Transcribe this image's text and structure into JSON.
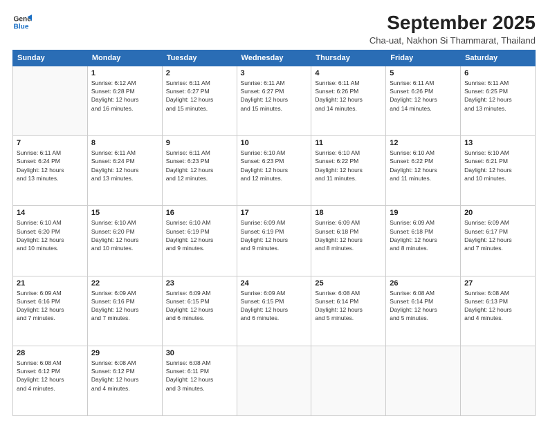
{
  "logo": {
    "line1": "General",
    "line2": "Blue"
  },
  "title": "September 2025",
  "subtitle": "Cha-uat, Nakhon Si Thammarat, Thailand",
  "days_of_week": [
    "Sunday",
    "Monday",
    "Tuesday",
    "Wednesday",
    "Thursday",
    "Friday",
    "Saturday"
  ],
  "weeks": [
    [
      {
        "day": "",
        "info": ""
      },
      {
        "day": "1",
        "info": "Sunrise: 6:12 AM\nSunset: 6:28 PM\nDaylight: 12 hours\nand 16 minutes."
      },
      {
        "day": "2",
        "info": "Sunrise: 6:11 AM\nSunset: 6:27 PM\nDaylight: 12 hours\nand 15 minutes."
      },
      {
        "day": "3",
        "info": "Sunrise: 6:11 AM\nSunset: 6:27 PM\nDaylight: 12 hours\nand 15 minutes."
      },
      {
        "day": "4",
        "info": "Sunrise: 6:11 AM\nSunset: 6:26 PM\nDaylight: 12 hours\nand 14 minutes."
      },
      {
        "day": "5",
        "info": "Sunrise: 6:11 AM\nSunset: 6:26 PM\nDaylight: 12 hours\nand 14 minutes."
      },
      {
        "day": "6",
        "info": "Sunrise: 6:11 AM\nSunset: 6:25 PM\nDaylight: 12 hours\nand 13 minutes."
      }
    ],
    [
      {
        "day": "7",
        "info": "Sunrise: 6:11 AM\nSunset: 6:24 PM\nDaylight: 12 hours\nand 13 minutes."
      },
      {
        "day": "8",
        "info": "Sunrise: 6:11 AM\nSunset: 6:24 PM\nDaylight: 12 hours\nand 13 minutes."
      },
      {
        "day": "9",
        "info": "Sunrise: 6:11 AM\nSunset: 6:23 PM\nDaylight: 12 hours\nand 12 minutes."
      },
      {
        "day": "10",
        "info": "Sunrise: 6:10 AM\nSunset: 6:23 PM\nDaylight: 12 hours\nand 12 minutes."
      },
      {
        "day": "11",
        "info": "Sunrise: 6:10 AM\nSunset: 6:22 PM\nDaylight: 12 hours\nand 11 minutes."
      },
      {
        "day": "12",
        "info": "Sunrise: 6:10 AM\nSunset: 6:22 PM\nDaylight: 12 hours\nand 11 minutes."
      },
      {
        "day": "13",
        "info": "Sunrise: 6:10 AM\nSunset: 6:21 PM\nDaylight: 12 hours\nand 10 minutes."
      }
    ],
    [
      {
        "day": "14",
        "info": "Sunrise: 6:10 AM\nSunset: 6:20 PM\nDaylight: 12 hours\nand 10 minutes."
      },
      {
        "day": "15",
        "info": "Sunrise: 6:10 AM\nSunset: 6:20 PM\nDaylight: 12 hours\nand 10 minutes."
      },
      {
        "day": "16",
        "info": "Sunrise: 6:10 AM\nSunset: 6:19 PM\nDaylight: 12 hours\nand 9 minutes."
      },
      {
        "day": "17",
        "info": "Sunrise: 6:09 AM\nSunset: 6:19 PM\nDaylight: 12 hours\nand 9 minutes."
      },
      {
        "day": "18",
        "info": "Sunrise: 6:09 AM\nSunset: 6:18 PM\nDaylight: 12 hours\nand 8 minutes."
      },
      {
        "day": "19",
        "info": "Sunrise: 6:09 AM\nSunset: 6:18 PM\nDaylight: 12 hours\nand 8 minutes."
      },
      {
        "day": "20",
        "info": "Sunrise: 6:09 AM\nSunset: 6:17 PM\nDaylight: 12 hours\nand 7 minutes."
      }
    ],
    [
      {
        "day": "21",
        "info": "Sunrise: 6:09 AM\nSunset: 6:16 PM\nDaylight: 12 hours\nand 7 minutes."
      },
      {
        "day": "22",
        "info": "Sunrise: 6:09 AM\nSunset: 6:16 PM\nDaylight: 12 hours\nand 7 minutes."
      },
      {
        "day": "23",
        "info": "Sunrise: 6:09 AM\nSunset: 6:15 PM\nDaylight: 12 hours\nand 6 minutes."
      },
      {
        "day": "24",
        "info": "Sunrise: 6:09 AM\nSunset: 6:15 PM\nDaylight: 12 hours\nand 6 minutes."
      },
      {
        "day": "25",
        "info": "Sunrise: 6:08 AM\nSunset: 6:14 PM\nDaylight: 12 hours\nand 5 minutes."
      },
      {
        "day": "26",
        "info": "Sunrise: 6:08 AM\nSunset: 6:14 PM\nDaylight: 12 hours\nand 5 minutes."
      },
      {
        "day": "27",
        "info": "Sunrise: 6:08 AM\nSunset: 6:13 PM\nDaylight: 12 hours\nand 4 minutes."
      }
    ],
    [
      {
        "day": "28",
        "info": "Sunrise: 6:08 AM\nSunset: 6:12 PM\nDaylight: 12 hours\nand 4 minutes."
      },
      {
        "day": "29",
        "info": "Sunrise: 6:08 AM\nSunset: 6:12 PM\nDaylight: 12 hours\nand 4 minutes."
      },
      {
        "day": "30",
        "info": "Sunrise: 6:08 AM\nSunset: 6:11 PM\nDaylight: 12 hours\nand 3 minutes."
      },
      {
        "day": "",
        "info": ""
      },
      {
        "day": "",
        "info": ""
      },
      {
        "day": "",
        "info": ""
      },
      {
        "day": "",
        "info": ""
      }
    ]
  ]
}
